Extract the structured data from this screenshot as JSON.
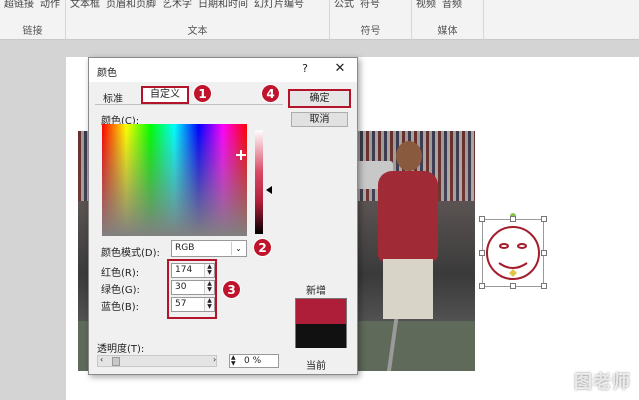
{
  "ribbon": {
    "groups": [
      {
        "label": "链接",
        "items": [
          "超链接",
          "动作"
        ]
      },
      {
        "label": "文本",
        "items": [
          "文本框",
          "页眉和页脚",
          "艺术字",
          "日期和时间",
          "幻灯片编号"
        ]
      },
      {
        "label": "符号",
        "items": [
          "公式",
          "符号"
        ]
      },
      {
        "label": "媒体",
        "items": [
          "视频",
          "音频"
        ]
      }
    ]
  },
  "dialog": {
    "title": "颜色",
    "help": "?",
    "close": "✕",
    "tabs": {
      "standard": "标准",
      "custom": "自定义"
    },
    "colors_label": "颜色(C):",
    "color_mode_label": "颜色模式(D):",
    "color_mode_value": "RGB",
    "red_label": "红色(R):",
    "red_value": "174",
    "green_label": "绿色(G):",
    "green_value": "30",
    "blue_label": "蓝色(B):",
    "blue_value": "57",
    "transparency_label": "透明度(T):",
    "transparency_value": "0 %",
    "ok": "确定",
    "cancel": "取消",
    "new_label": "新增",
    "current_label": "当前",
    "new_color": "#ae1e39",
    "current_color": "#111111"
  },
  "steps": [
    "1",
    "2",
    "3",
    "4"
  ],
  "watermark": "图老师"
}
